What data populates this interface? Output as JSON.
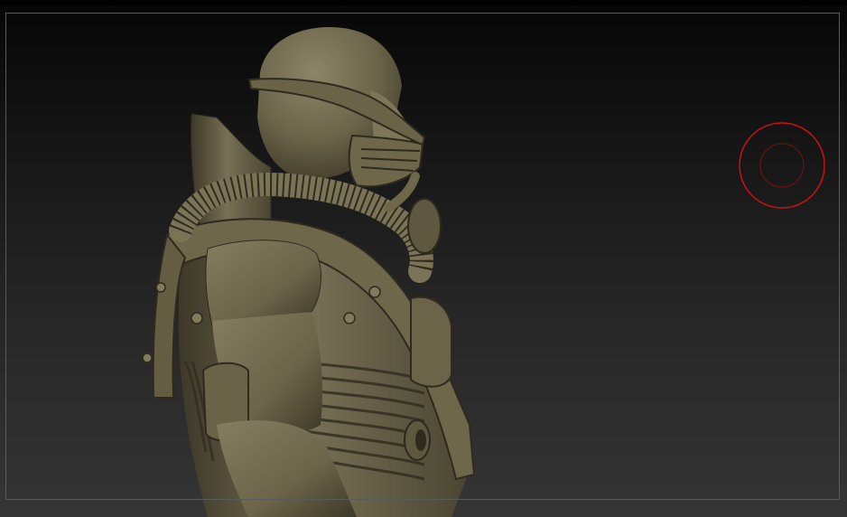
{
  "app": {
    "view": "sculpt-viewport",
    "content": "sculpted-figure-side-view",
    "brush_cursor": "visible"
  },
  "colors": {
    "clay": "#6b6449",
    "clay_highlight": "#8c8566",
    "clay_shadow": "#3a3526",
    "brush_ring": "#cc1111",
    "frame": "#5a5a5a"
  },
  "icons": [
    "brush-cursor-icon"
  ]
}
